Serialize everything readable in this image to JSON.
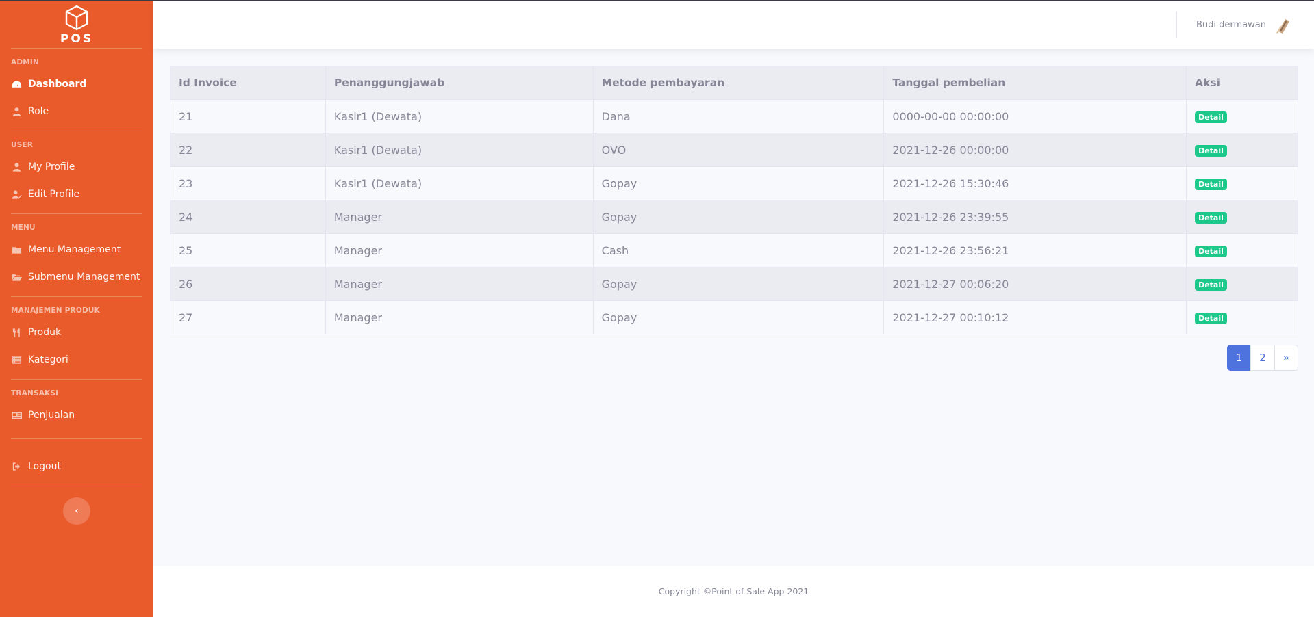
{
  "brand": {
    "logo_text": "POS"
  },
  "sidebar": {
    "sections": [
      {
        "heading": "Admin",
        "items": [
          {
            "label": "Dashboard",
            "icon": "tachometer-icon",
            "active": true
          },
          {
            "label": "Role",
            "icon": "user-icon"
          }
        ]
      },
      {
        "heading": "User",
        "items": [
          {
            "label": "My Profile",
            "icon": "user-icon"
          },
          {
            "label": "Edit Profile",
            "icon": "user-edit-icon"
          }
        ]
      },
      {
        "heading": "Menu",
        "items": [
          {
            "label": "Menu Management",
            "icon": "folder-icon"
          },
          {
            "label": "Submenu Management",
            "icon": "folder-open-icon"
          }
        ]
      },
      {
        "heading": "Manajemen Produk",
        "items": [
          {
            "label": "Produk",
            "icon": "utensils-icon"
          },
          {
            "label": "Kategori",
            "icon": "list-icon"
          }
        ]
      },
      {
        "heading": "Transaksi",
        "items": [
          {
            "label": "Penjualan",
            "icon": "receipt-icon"
          }
        ]
      }
    ],
    "logout_label": "Logout",
    "colors": {
      "background": "#ea5b2c"
    }
  },
  "topbar": {
    "user_name": "Budi dermawan"
  },
  "table": {
    "headers": [
      "Id Invoice",
      "Penanggungjawab",
      "Metode pembayaran",
      "Tanggal pembelian",
      "Aksi"
    ],
    "rows": [
      [
        "21",
        "Kasir1 (Dewata)",
        "Dana",
        "0000-00-00 00:00:00",
        "Detail"
      ],
      [
        "22",
        "Kasir1 (Dewata)",
        "OVO",
        "2021-12-26 00:00:00",
        "Detail"
      ],
      [
        "23",
        "Kasir1 (Dewata)",
        "Gopay",
        "2021-12-26 15:30:46",
        "Detail"
      ],
      [
        "24",
        "Manager",
        "Gopay",
        "2021-12-26 23:39:55",
        "Detail"
      ],
      [
        "25",
        "Manager",
        "Cash",
        "2021-12-26 23:56:21",
        "Detail"
      ],
      [
        "26",
        "Manager",
        "Gopay",
        "2021-12-27 00:06:20",
        "Detail"
      ],
      [
        "27",
        "Manager",
        "Gopay",
        "2021-12-27 00:10:12",
        "Detail"
      ]
    ]
  },
  "pagination": {
    "pages": [
      "1",
      "2",
      "»"
    ],
    "active": "1"
  },
  "footer": {
    "text": "Copyright ©Point of Sale App 2021"
  }
}
